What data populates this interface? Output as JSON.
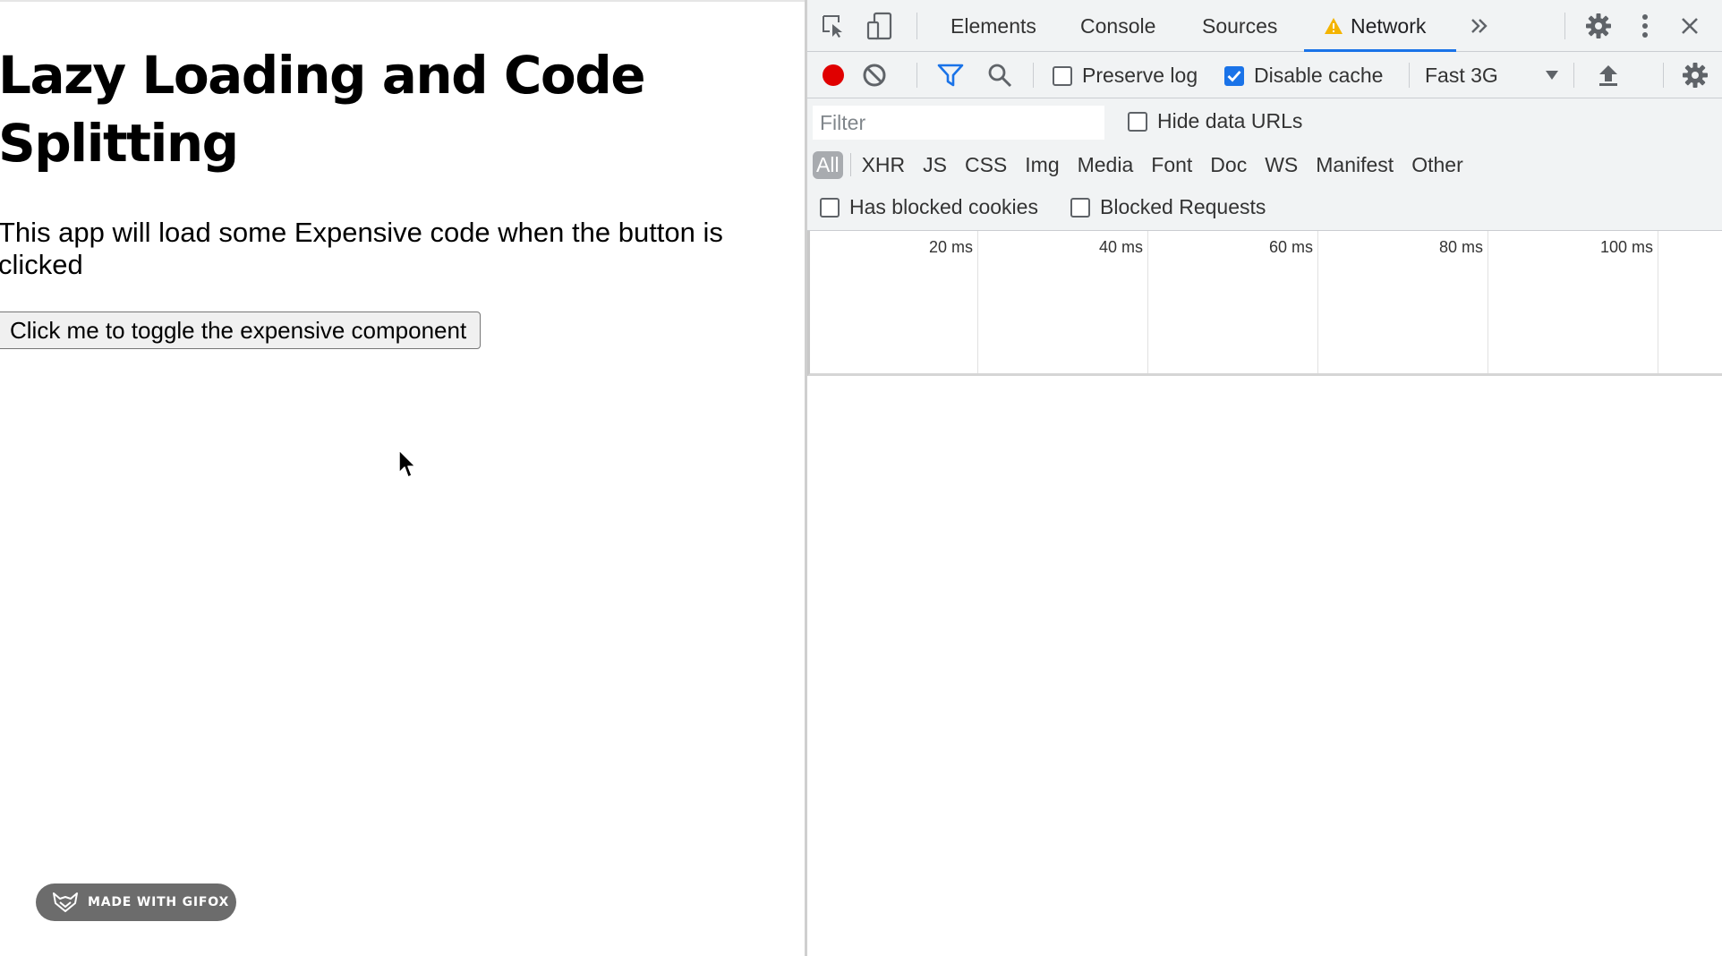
{
  "page": {
    "title": "Lazy Loading and Code Splitting",
    "description": "This app will load some Expensive code when the button is clicked",
    "toggle_button": "Click me to toggle the expensive component"
  },
  "watermark": {
    "text": "MADE WITH GIFOX",
    "icon": "fox-icon"
  },
  "devtools": {
    "tabs": [
      {
        "label": "Elements",
        "active": false
      },
      {
        "label": "Console",
        "active": false
      },
      {
        "label": "Sources",
        "active": false
      },
      {
        "label": "Network",
        "active": true,
        "warning": true
      }
    ],
    "more_tabs_icon": "double-chevron-right-icon",
    "toolbar": {
      "record_icon": "record-icon",
      "clear_icon": "clear-icon",
      "filter_icon": "filter-icon",
      "search_icon": "search-icon",
      "preserve_log": {
        "label": "Preserve log",
        "checked": false
      },
      "disable_cache": {
        "label": "Disable cache",
        "checked": true
      },
      "throttling": "Fast 3G",
      "import_icon": "upload-icon",
      "settings_icon": "gear-icon"
    },
    "filter": {
      "placeholder": "Filter",
      "value": "",
      "hide_data_urls": {
        "label": "Hide data URLs",
        "checked": false
      }
    },
    "resource_types": [
      "All",
      "XHR",
      "JS",
      "CSS",
      "Img",
      "Media",
      "Font",
      "Doc",
      "WS",
      "Manifest",
      "Other"
    ],
    "active_resource_type": "All",
    "has_blocked_cookies": {
      "label": "Has blocked cookies",
      "checked": false
    },
    "blocked_requests": {
      "label": "Blocked Requests",
      "checked": false
    },
    "timeline_ticks": [
      "20 ms",
      "40 ms",
      "60 ms",
      "80 ms",
      "100 ms"
    ]
  },
  "colors": {
    "record": "#e00000",
    "accent": "#1a73e8",
    "warning": "#f4b400",
    "devtools_bg": "#f1f3f4"
  }
}
